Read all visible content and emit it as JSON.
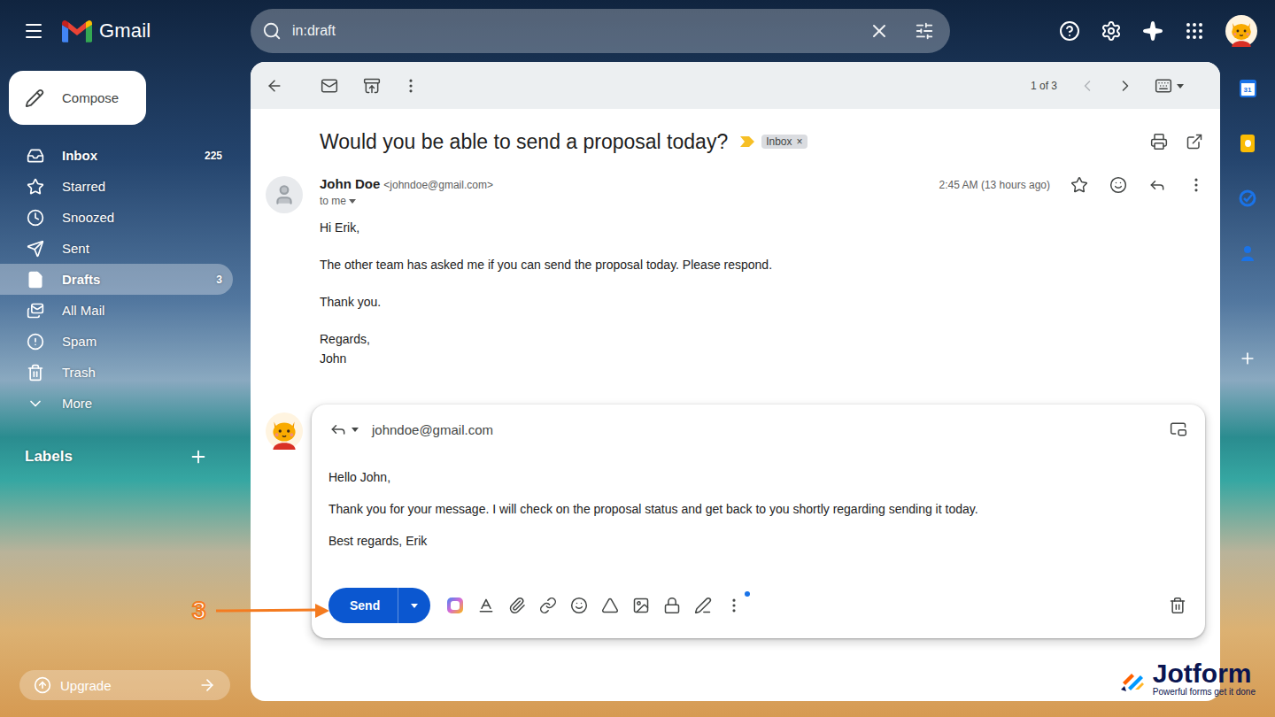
{
  "app": {
    "logo_text": "Gmail"
  },
  "search": {
    "query": "in:draft"
  },
  "compose": {
    "label": "Compose"
  },
  "sidebar": {
    "items": [
      {
        "label": "Inbox",
        "count": "225",
        "selected": false,
        "bold": true
      },
      {
        "label": "Starred",
        "selected": false,
        "bold": false
      },
      {
        "label": "Snoozed",
        "selected": false,
        "bold": false
      },
      {
        "label": "Sent",
        "selected": false,
        "bold": false
      },
      {
        "label": "Drafts",
        "count": "3",
        "selected": true,
        "bold": true
      },
      {
        "label": "All Mail",
        "selected": false,
        "bold": false
      },
      {
        "label": "Spam",
        "selected": false,
        "bold": false
      },
      {
        "label": "Trash",
        "selected": false,
        "bold": false
      },
      {
        "label": "More",
        "selected": false,
        "bold": false
      }
    ]
  },
  "labels": {
    "title": "Labels"
  },
  "upgrade": {
    "label": "Upgrade"
  },
  "toolbar": {
    "pagination": "1 of 3"
  },
  "thread": {
    "subject": "Would you be able to send a proposal today?",
    "important": true,
    "tags": [
      {
        "label": "Inbox",
        "remove": "×"
      }
    ]
  },
  "message": {
    "sender_name": "John Doe",
    "sender_email": "<johndoe@gmail.com>",
    "recipient": "to me",
    "time": "2:45 AM (13 hours ago)",
    "starred": false,
    "paragraphs": [
      [
        "Hi Erik,"
      ],
      [
        "The other team has asked me if you can send the proposal today. Please respond."
      ],
      [
        "Thank you."
      ],
      [
        "Regards,",
        "John"
      ]
    ]
  },
  "reply": {
    "to": "johndoe@gmail.com",
    "paragraphs": [
      [
        "Hello John,"
      ],
      [
        "Thank you for your message. I will check on the proposal status and get back to you shortly regarding sending it today."
      ],
      [
        "Best regards, Erik"
      ]
    ],
    "send_label": "Send",
    "more_options_dot": true
  },
  "annotation": {
    "label": "3"
  },
  "side_panel": {
    "calendar_day": "31"
  },
  "watermark": {
    "name": "Jotform",
    "tagline": "Powerful forms get it done"
  }
}
